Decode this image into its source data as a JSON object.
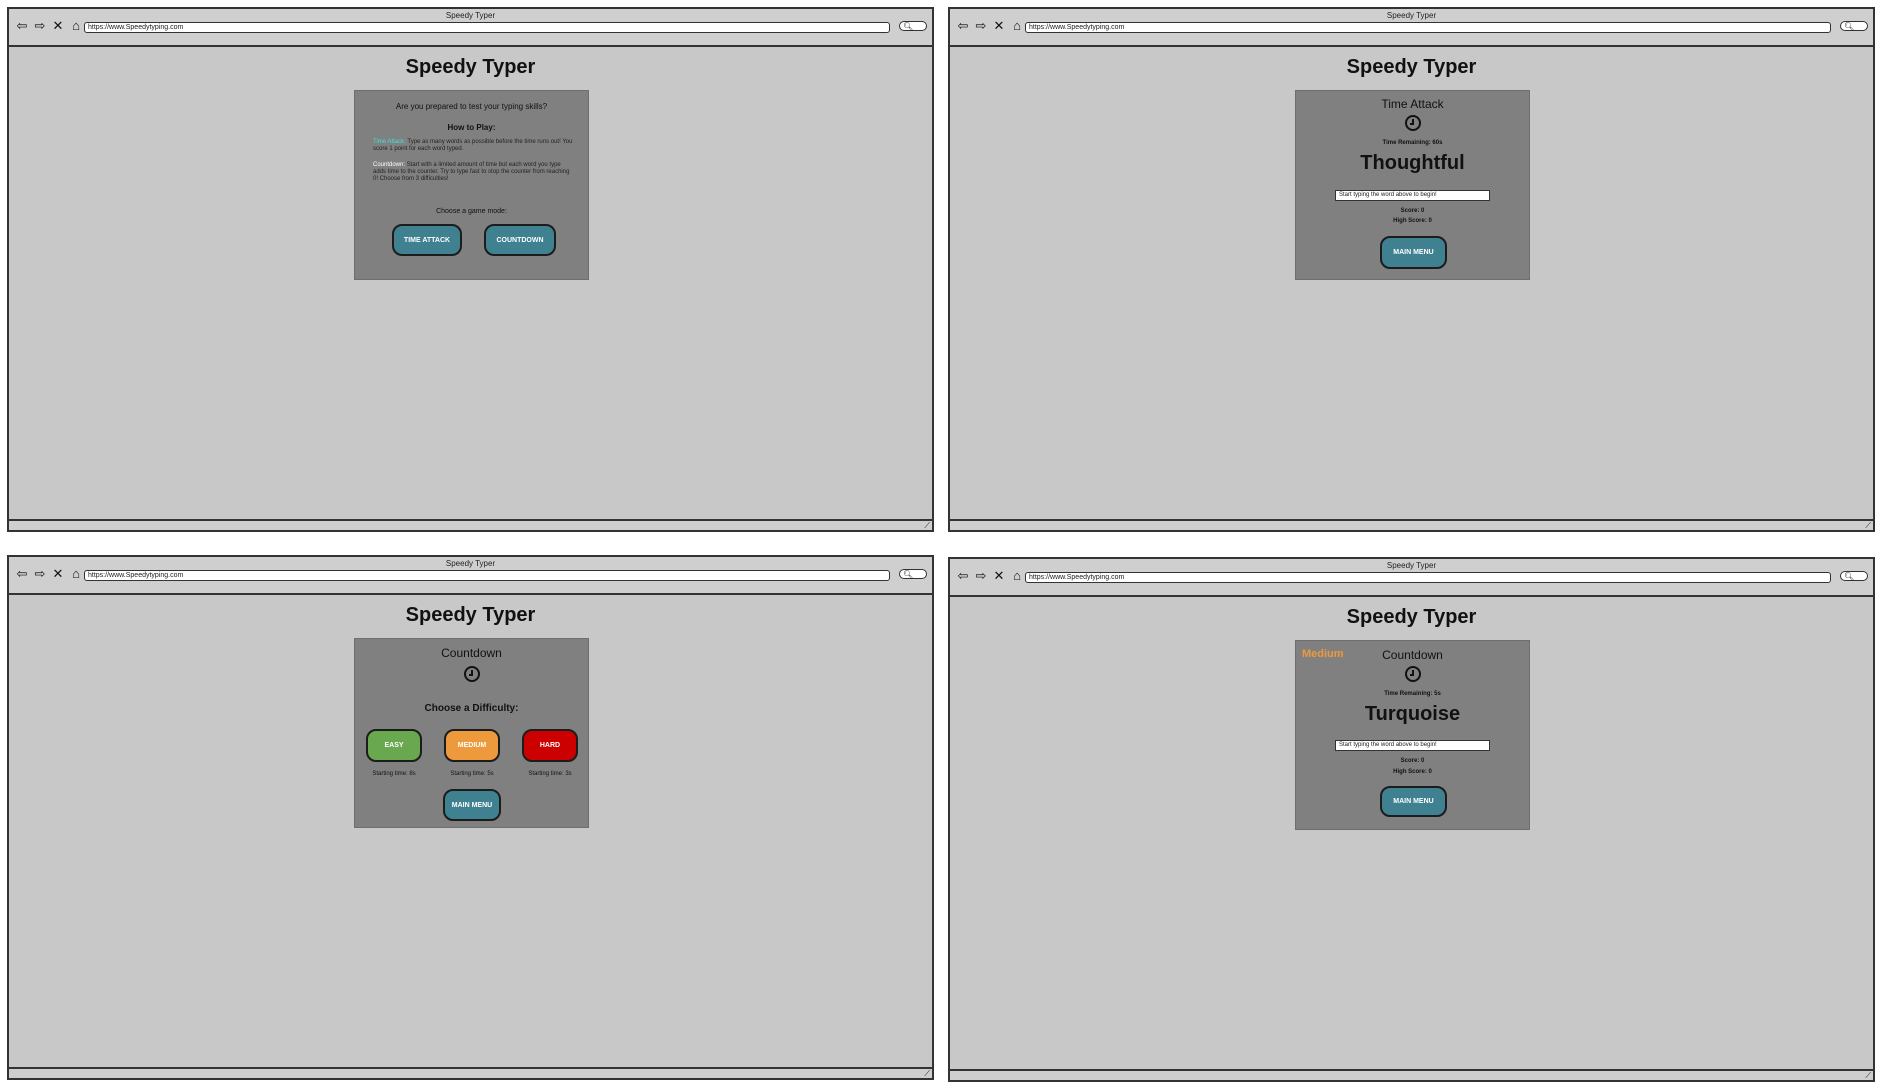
{
  "browser": {
    "window_title": "Speedy Typer",
    "url": "https://www.Speedytyping.com",
    "nav_icons": [
      "back-arrow-icon",
      "forward-arrow-icon",
      "stop-icon",
      "home-icon"
    ],
    "nav_glyphs": [
      "⇦",
      "⇨",
      "✕",
      "⌂"
    ],
    "search_glyph": "🔍︎"
  },
  "app": {
    "title": "Speedy Typer"
  },
  "main_menu_screen": {
    "question": "Are you prepared to test your typing skills?",
    "how_to_play": "How to Play:",
    "time_attack_label": "Time Attack:",
    "time_attack_desc": " Type as many words as possible before the time runs out! You score 1 point for each word typed.",
    "countdown_label": "Countdown:",
    "countdown_desc": " Start with a limited amount of time but each word you type adds time to the counter. Try to type fast to stop the counter from reaching 0! Choose from 3 difficulties!",
    "choose_mode": "Choose a game mode:",
    "time_attack_button": "TIME ATTACK",
    "countdown_button": "COUNTDOWN"
  },
  "time_attack_screen": {
    "mode_title": "Time Attack",
    "time_remaining": "Time Remaining: 60s",
    "word": "Thoughtful",
    "input_placeholder": "Start typing the word above to begin!",
    "score": "Score: 0",
    "high_score": "High Score: 0",
    "main_menu_button": "MAIN MENU"
  },
  "difficulty_screen": {
    "mode_title": "Countdown",
    "choose_difficulty": "Choose a Difficulty:",
    "easy_button": "EASY",
    "medium_button": "MEDIUM",
    "hard_button": "HARD",
    "easy_start": "Starting time: 8s",
    "medium_start": "Starting time: 5s",
    "hard_start": "Starting time: 3s",
    "main_menu_button": "MAIN MENU"
  },
  "countdown_screen": {
    "difficulty": "Medium",
    "mode_title": "Countdown",
    "time_remaining": "Time Remaining: 5s",
    "word": "Turquoise",
    "input_placeholder": "Start typing the word above to begin!",
    "score": "Score: 0",
    "high_score": "High Score: 0",
    "main_menu_button": "MAIN MENU"
  },
  "colors": {
    "teal_button": "#3f8091",
    "easy": "#6aa84f",
    "medium": "#ec9a3c",
    "hard": "#cc0000",
    "panel": "#808080",
    "highlight": "#40e0d0"
  }
}
